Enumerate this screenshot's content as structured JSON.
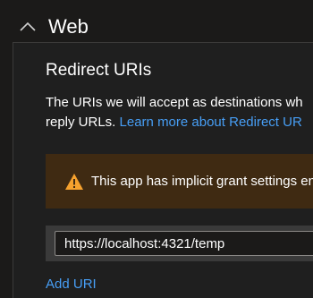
{
  "section": {
    "title": "Web",
    "expanded": true
  },
  "redirect": {
    "heading": "Redirect URIs",
    "description_line1": "The URIs we will accept as destinations wh",
    "description_line2_prefix": "reply URLs. ",
    "learn_more_link": "Learn more about Redirect UR"
  },
  "warning": {
    "text": "This app has implicit grant settings en",
    "icon": "warning-triangle-icon",
    "accent_color": "#f7a22e",
    "background_color": "#3f2a12"
  },
  "uris": [
    {
      "value": "https://localhost:4321/temp"
    }
  ],
  "add_uri_label": "Add URI",
  "colors": {
    "link": "#479ef5",
    "background": "#1b1a19"
  }
}
